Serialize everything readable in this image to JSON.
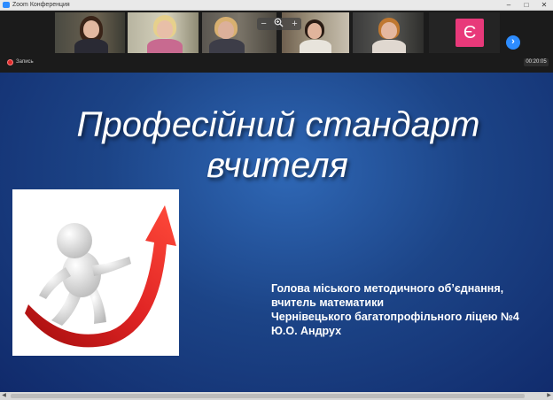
{
  "window": {
    "title": "Zoom Конференция",
    "controls": {
      "minimize": "–",
      "maximize": "□",
      "close": "✕"
    }
  },
  "meeting": {
    "zoom_controls": {
      "minus": "−",
      "plus": "+"
    },
    "participants": [
      {
        "label": "participant-1"
      },
      {
        "label": "participant-2"
      },
      {
        "label": "participant-3"
      },
      {
        "label": "participant-4"
      },
      {
        "label": "participant-5"
      },
      {
        "label": "participant-6",
        "initial": "Є"
      }
    ],
    "next_arrow": "›",
    "recording_label": "Запись",
    "timer": "00:20:05"
  },
  "slide": {
    "title_line1": "Професійний стандарт",
    "title_line2": "вчителя",
    "author_lines": [
      "Голова міського методичного об’єднання,",
      "вчитель математики",
      "Чернівецького багатопрофільного ліцею №4",
      "Ю.О.  Андрух"
    ]
  },
  "scrollbar": {
    "left_arrow": "◀",
    "right_arrow": "▶"
  },
  "colors": {
    "slide_bg": "#1c4487",
    "zoom_blue": "#2d8cff",
    "initial_badge": "#e8397a",
    "record_red": "#e02b2b",
    "arrow_red": "#d41f1f"
  }
}
